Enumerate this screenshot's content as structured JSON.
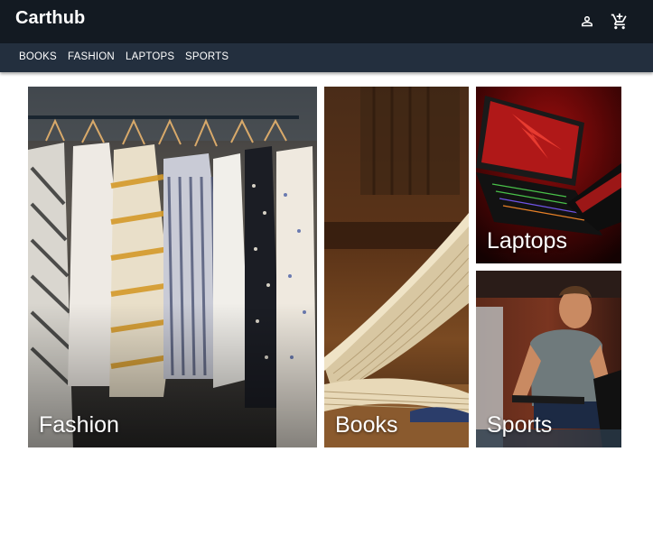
{
  "header": {
    "brand": "Carthub",
    "account_icon": "person-outline-icon",
    "cart_icon": "add-shopping-cart-icon"
  },
  "nav": {
    "items": [
      {
        "label": "BOOKS"
      },
      {
        "label": "FASHION"
      },
      {
        "label": "LAPTOPS"
      },
      {
        "label": "SPORTS"
      }
    ]
  },
  "categories": {
    "fashion": {
      "label": "Fashion",
      "image": "clothes-on-rack-photo"
    },
    "books": {
      "label": "Books",
      "image": "open-book-photo"
    },
    "laptops": {
      "label": "Laptops",
      "image": "gaming-laptop-photo"
    },
    "sports": {
      "label": "Sports",
      "image": "man-on-exercise-bike-photo"
    }
  },
  "colors": {
    "topbar": "#131a22",
    "subnav": "#232f3e",
    "text": "#ffffff"
  }
}
